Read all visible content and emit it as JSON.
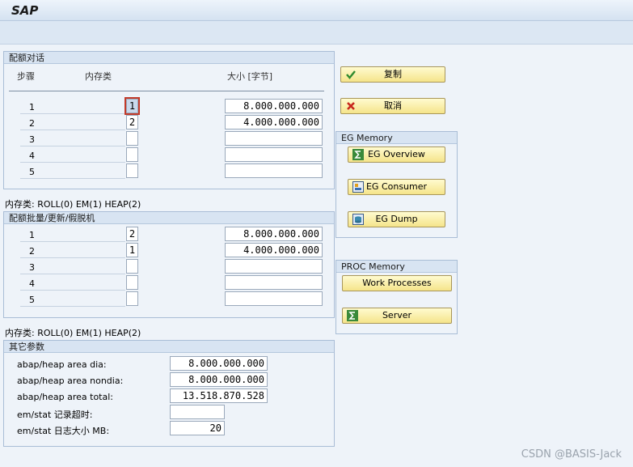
{
  "app": {
    "title": "SAP"
  },
  "quota_dialog": {
    "title": "配额对话",
    "col_step": "步骤",
    "col_memtype": "内存类",
    "col_size": "大小 [字节]",
    "rows": [
      {
        "step": "1",
        "type": "1",
        "size": "8.000.000.000"
      },
      {
        "step": "2",
        "type": "2",
        "size": "4.000.000.000"
      },
      {
        "step": "3",
        "type": "",
        "size": ""
      },
      {
        "step": "4",
        "type": "",
        "size": ""
      },
      {
        "step": "5",
        "type": "",
        "size": ""
      }
    ]
  },
  "memtype_note_1": "内存类: ROLL(0) EM(1) HEAP(2)",
  "quota_batch": {
    "title": "配额批量/更新/假脱机",
    "rows": [
      {
        "step": "1",
        "type": "2",
        "size": "8.000.000.000"
      },
      {
        "step": "2",
        "type": "1",
        "size": "4.000.000.000"
      },
      {
        "step": "3",
        "type": "",
        "size": ""
      },
      {
        "step": "4",
        "type": "",
        "size": ""
      },
      {
        "step": "5",
        "type": "",
        "size": ""
      }
    ]
  },
  "memtype_note_2": "内存类: ROLL(0) EM(1) HEAP(2)",
  "other_params": {
    "title": "其它参数",
    "rows": [
      {
        "label": "abap/heap area dia:",
        "value": "8.000.000.000"
      },
      {
        "label": "abap/heap area nondia:",
        "value": "8.000.000.000"
      },
      {
        "label": "abap/heap area total:",
        "value": "13.518.870.528"
      },
      {
        "label": "em/stat 记录超时:",
        "value": ""
      },
      {
        "label": "em/stat 日志大小 MB:",
        "value": "20"
      }
    ]
  },
  "actions": {
    "copy_label": "复制",
    "cancel_label": "取消"
  },
  "eg_memory": {
    "title": "EG Memory",
    "overview_label": "EG Overview",
    "consumer_label": "EG Consumer",
    "dump_label": "EG Dump"
  },
  "proc_memory": {
    "title": "PROC Memory",
    "work_processes_label": "Work Processes",
    "server_label": "Server"
  },
  "watermark": "CSDN @BASIS-Jack"
}
